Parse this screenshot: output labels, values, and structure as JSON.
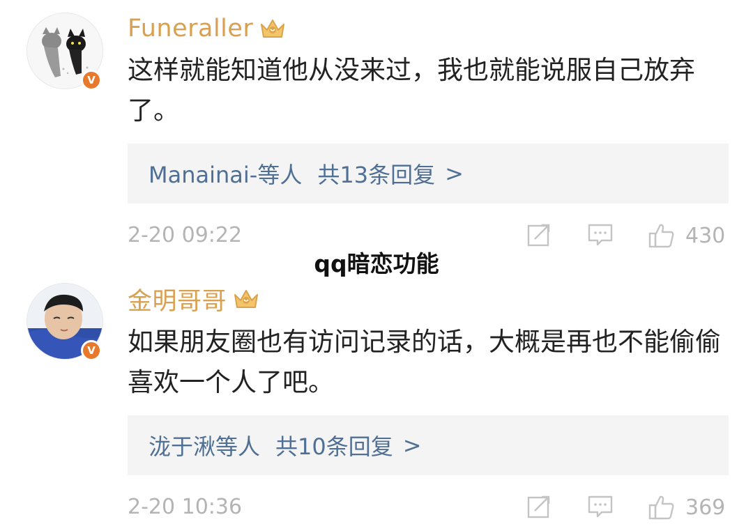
{
  "overlay_title": "qq暗恋功能",
  "colors": {
    "username": "#d9a14f",
    "reply_link": "#4f6f94",
    "meta": "#b4b4b4",
    "badge": "#e8792c",
    "reply_bg": "#f4f4f4"
  },
  "comments": [
    {
      "username": "Funeraller",
      "avatar_icon": "cats-avatar-icon",
      "badge_icon": "verified-v-icon",
      "badge_label": "V",
      "member_icon": "vip-crown-icon",
      "content": "这样就能知道他从没来过，我也就能说服自己放弃了。",
      "replies": {
        "users": "Manainai-等人",
        "count": "共13条回复",
        "arrow": ">"
      },
      "timestamp": "2-20 09:22",
      "actions": {
        "share_icon": "share-icon",
        "comment_icon": "comment-icon",
        "like_icon": "thumbs-up-icon",
        "likes": "430"
      }
    },
    {
      "username": "金明哥哥",
      "avatar_icon": "person-avatar-icon",
      "badge_icon": "verified-v-icon",
      "badge_label": "V",
      "member_icon": "vip-crown-icon",
      "content": "如果朋友圈也有访问记录的话，大概是再也不能偷偷喜欢一个人了吧。",
      "replies": {
        "users": "泷于湫等人",
        "count": "共10条回复",
        "arrow": ">"
      },
      "timestamp": "2-20 10:36",
      "actions": {
        "share_icon": "share-icon",
        "comment_icon": "comment-icon",
        "like_icon": "thumbs-up-icon",
        "likes": "369"
      }
    }
  ]
}
